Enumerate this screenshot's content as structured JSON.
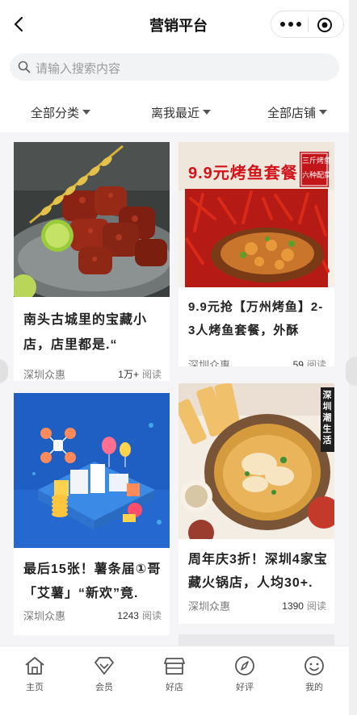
{
  "nav": {
    "title": "营销平台"
  },
  "search": {
    "placeholder": "请输入搜索内容"
  },
  "filters": [
    {
      "label": "全部分类"
    },
    {
      "label": "离我最近"
    },
    {
      "label": "全部店铺"
    }
  ],
  "cards": [
    {
      "title_line1": "南头古城里的宝藏小",
      "title_line2": "店，店里都是.“",
      "source": "深圳众惠",
      "reads": "1万+",
      "reads_unit": "阅读"
    },
    {
      "title_line1": "9.9元抢【万州烤鱼】2-",
      "title_line2": "3人烤鱼套餐，外酥",
      "source": "深圳众惠",
      "reads": "59",
      "reads_unit": "阅读",
      "poster_headline": "9.9元烤鱼套餐",
      "poster_tag_line1": "三斤烤鱼",
      "poster_tag_line2": "六种配菜"
    },
    {
      "title_line1": "最后15张！薯条届①哥",
      "title_line2": "「艾薯」“新欢”竟.",
      "source": "深圳众惠",
      "reads": "1243",
      "reads_unit": "阅读"
    },
    {
      "title_line1": "周年庆3折！深圳4家宝",
      "title_line2": "藏火锅店，人均30+.",
      "source": "深圳众惠",
      "reads": "1390",
      "reads_unit": "阅读",
      "poster_tag": "深圳潮生活"
    }
  ],
  "tabs": [
    {
      "label": "主页",
      "icon": "home-icon"
    },
    {
      "label": "会员",
      "icon": "diamond-icon"
    },
    {
      "label": "好店",
      "icon": "shop-icon"
    },
    {
      "label": "好评",
      "icon": "compass-icon"
    },
    {
      "label": "我的",
      "icon": "smile-icon"
    }
  ],
  "colors": {
    "accent": "#e60012",
    "background": "#f5f5f7",
    "text": "#222222"
  }
}
